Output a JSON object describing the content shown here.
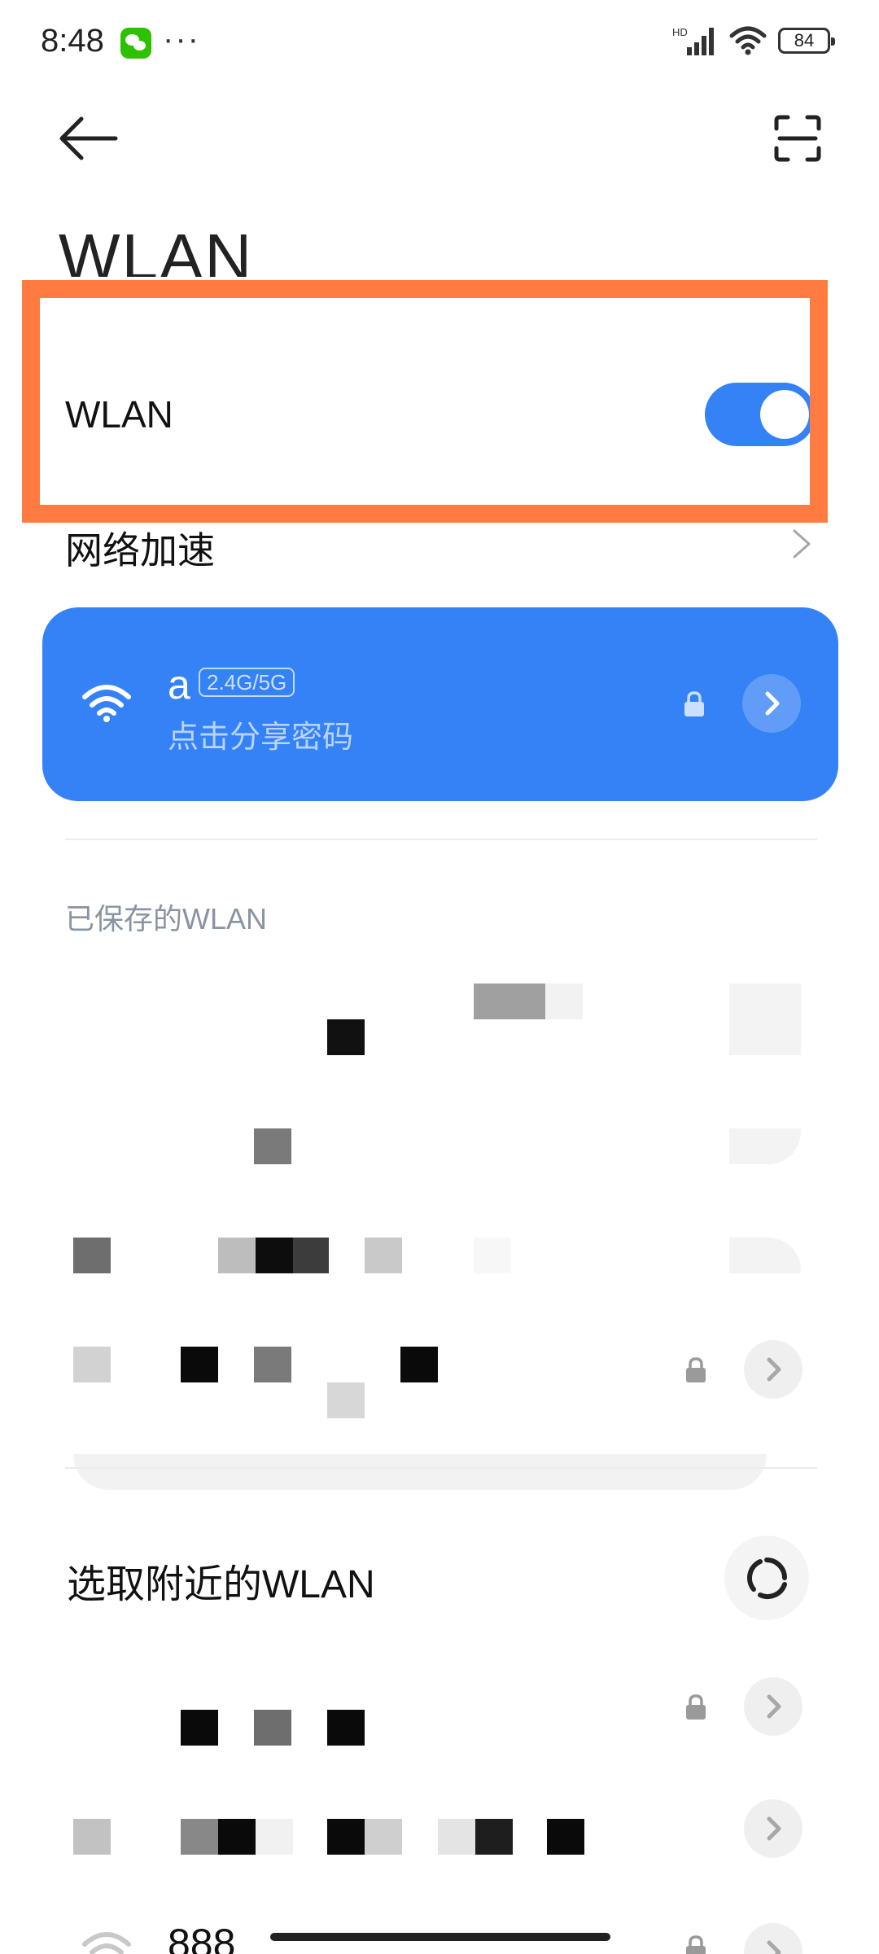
{
  "status_bar": {
    "time": "8:48",
    "more": "···",
    "network_label": "HD",
    "battery": "84",
    "icons": [
      "wechat-icon",
      "signal-icon",
      "wifi-icon",
      "battery-icon"
    ]
  },
  "header": {
    "title": "WLAN",
    "icons": [
      "back-arrow-icon",
      "scan-icon"
    ]
  },
  "wlan_toggle": {
    "label": "WLAN",
    "enabled": true,
    "accent_color": "#3482f6",
    "highlight_color": "#ff7b42"
  },
  "network_accel": {
    "label": "网络加速"
  },
  "current_network": {
    "ssid": "a",
    "band": "2.4G/5G",
    "subtitle": "点击分享密码",
    "card_color": "#3582f6"
  },
  "saved": {
    "section_label": "已保存的WLAN"
  },
  "nearby": {
    "title": "选取附近的WLAN",
    "visible_ssid": "888"
  }
}
